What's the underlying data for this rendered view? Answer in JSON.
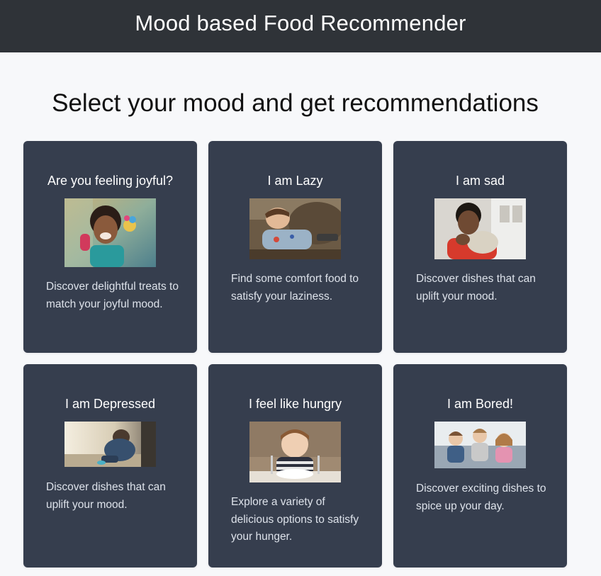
{
  "header": {
    "title": "Mood based Food Recommender"
  },
  "main": {
    "heading": "Select your mood and get recommendations"
  },
  "cards": [
    {
      "title": "Are you feeling joyful?",
      "image": "joyful-child-photo",
      "description": "Discover delightful treats to match your joyful mood."
    },
    {
      "title": "I am Lazy",
      "image": "lazy-child-on-couch-photo",
      "description": "Find some comfort food to satisfy your laziness."
    },
    {
      "title": "I am sad",
      "image": "sad-child-photo",
      "description": "Discover dishes that can uplift your mood."
    },
    {
      "title": "I am Depressed",
      "image": "depressed-child-photo",
      "description": "Discover dishes that can uplift your mood."
    },
    {
      "title": "I feel like hungry",
      "image": "hungry-child-with-plate-photo",
      "description": "Explore a variety of delicious options to satisfy your hunger."
    },
    {
      "title": "I am Bored!",
      "image": "bored-children-on-couch-photo",
      "description": "Discover exciting dishes to spice up your day."
    }
  ],
  "colors": {
    "header_bg": "#2f3338",
    "page_bg": "#f7f8fa",
    "card_bg": "#363e4e",
    "card_text": "#dde2ea"
  }
}
